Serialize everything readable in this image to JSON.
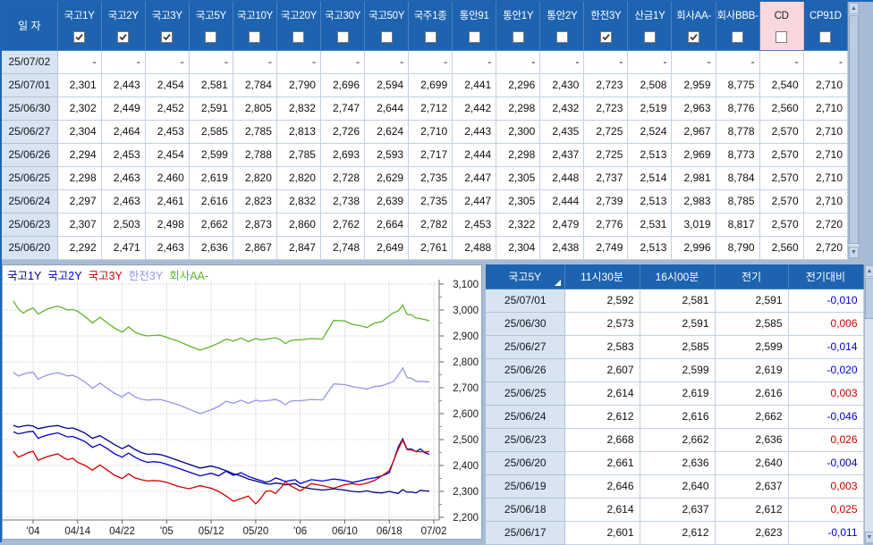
{
  "colors": {
    "header_blue": "#1E63B0",
    "date_col_bg": "#D8E4F1",
    "cd_header_pink": "#F8D8DC",
    "diff_positive": "#CC0000",
    "diff_negative": "#0000CC",
    "frame_bg": "#A8BBD5"
  },
  "top_table": {
    "date_header": "일 자",
    "columns": [
      {
        "label": "국고1Y",
        "checked": true,
        "pink": false
      },
      {
        "label": "국고2Y",
        "checked": true,
        "pink": false
      },
      {
        "label": "국고3Y",
        "checked": true,
        "pink": false
      },
      {
        "label": "국고5Y",
        "checked": false,
        "pink": false
      },
      {
        "label": "국고10Y",
        "checked": false,
        "pink": false
      },
      {
        "label": "국고20Y",
        "checked": false,
        "pink": false
      },
      {
        "label": "국고30Y",
        "checked": false,
        "pink": false
      },
      {
        "label": "국고50Y",
        "checked": false,
        "pink": false
      },
      {
        "label": "국주1종",
        "checked": false,
        "pink": false
      },
      {
        "label": "통안91",
        "checked": false,
        "pink": false
      },
      {
        "label": "통안1Y",
        "checked": false,
        "pink": false
      },
      {
        "label": "통안2Y",
        "checked": false,
        "pink": false
      },
      {
        "label": "한전3Y",
        "checked": true,
        "pink": false
      },
      {
        "label": "산금1Y",
        "checked": false,
        "pink": false
      },
      {
        "label": "회사AA-",
        "checked": true,
        "pink": false
      },
      {
        "label": "회사BBB-",
        "checked": false,
        "pink": false
      },
      {
        "label": "CD",
        "checked": false,
        "pink": true
      },
      {
        "label": "CP91D",
        "checked": false,
        "pink": false
      }
    ],
    "rows": [
      {
        "date": "25/07/02",
        "values": [
          "-",
          "-",
          "-",
          "-",
          "-",
          "-",
          "-",
          "-",
          "-",
          "-",
          "-",
          "-",
          "-",
          "-",
          "-",
          "-",
          "-",
          "-"
        ]
      },
      {
        "date": "25/07/01",
        "values": [
          "2,301",
          "2,443",
          "2,454",
          "2,581",
          "2,784",
          "2,790",
          "2,696",
          "2,594",
          "2,699",
          "2,441",
          "2,296",
          "2,430",
          "2,723",
          "2,508",
          "2,959",
          "8,775",
          "2,540",
          "2,710"
        ]
      },
      {
        "date": "25/06/30",
        "values": [
          "2,302",
          "2,449",
          "2,452",
          "2,591",
          "2,805",
          "2,832",
          "2,747",
          "2,644",
          "2,712",
          "2,442",
          "2,298",
          "2,432",
          "2,723",
          "2,519",
          "2,963",
          "8,776",
          "2,560",
          "2,710"
        ]
      },
      {
        "date": "25/06/27",
        "values": [
          "2,304",
          "2,464",
          "2,453",
          "2,585",
          "2,785",
          "2,813",
          "2,726",
          "2,624",
          "2,710",
          "2,443",
          "2,300",
          "2,435",
          "2,725",
          "2,524",
          "2,967",
          "8,778",
          "2,570",
          "2,710"
        ]
      },
      {
        "date": "25/06/26",
        "values": [
          "2,294",
          "2,453",
          "2,454",
          "2,599",
          "2,788",
          "2,785",
          "2,693",
          "2,593",
          "2,717",
          "2,444",
          "2,298",
          "2,437",
          "2,725",
          "2,513",
          "2,969",
          "8,773",
          "2,570",
          "2,710"
        ]
      },
      {
        "date": "25/06/25",
        "values": [
          "2,298",
          "2,463",
          "2,460",
          "2,619",
          "2,820",
          "2,820",
          "2,728",
          "2,629",
          "2,735",
          "2,447",
          "2,305",
          "2,448",
          "2,737",
          "2,514",
          "2,981",
          "8,784",
          "2,570",
          "2,710"
        ]
      },
      {
        "date": "25/06/24",
        "values": [
          "2,297",
          "2,463",
          "2,461",
          "2,616",
          "2,823",
          "2,832",
          "2,738",
          "2,639",
          "2,735",
          "2,447",
          "2,305",
          "2,444",
          "2,739",
          "2,513",
          "2,983",
          "8,785",
          "2,570",
          "2,710"
        ]
      },
      {
        "date": "25/06/23",
        "values": [
          "2,307",
          "2,503",
          "2,498",
          "2,662",
          "2,873",
          "2,860",
          "2,762",
          "2,664",
          "2,782",
          "2,453",
          "2,322",
          "2,479",
          "2,776",
          "2,531",
          "3,019",
          "8,817",
          "2,570",
          "2,720"
        ]
      },
      {
        "date": "25/06/20",
        "values": [
          "2,292",
          "2,471",
          "2,463",
          "2,636",
          "2,867",
          "2,847",
          "2,748",
          "2,649",
          "2,761",
          "2,488",
          "2,304",
          "2,438",
          "2,749",
          "2,513",
          "2,996",
          "8,790",
          "2,560",
          "2,720"
        ]
      }
    ]
  },
  "detail_table": {
    "columns": [
      "국고5Y",
      "11시30분",
      "16시00분",
      "전기",
      "전기대비"
    ],
    "rows": [
      {
        "date": "25/07/01",
        "t1130": "2,592",
        "t1600": "2,581",
        "prev": "2,591",
        "diff": "-0,010"
      },
      {
        "date": "25/06/30",
        "t1130": "2,573",
        "t1600": "2,591",
        "prev": "2,585",
        "diff": "0,006"
      },
      {
        "date": "25/06/27",
        "t1130": "2,583",
        "t1600": "2,585",
        "prev": "2,599",
        "diff": "-0,014"
      },
      {
        "date": "25/06/26",
        "t1130": "2,607",
        "t1600": "2,599",
        "prev": "2,619",
        "diff": "-0,020"
      },
      {
        "date": "25/06/25",
        "t1130": "2,614",
        "t1600": "2,619",
        "prev": "2,616",
        "diff": "0,003"
      },
      {
        "date": "25/06/24",
        "t1130": "2,612",
        "t1600": "2,616",
        "prev": "2,662",
        "diff": "-0,046"
      },
      {
        "date": "25/06/23",
        "t1130": "2,668",
        "t1600": "2,662",
        "prev": "2,636",
        "diff": "0,026"
      },
      {
        "date": "25/06/20",
        "t1130": "2,661",
        "t1600": "2,636",
        "prev": "2,640",
        "diff": "-0,004"
      },
      {
        "date": "25/06/19",
        "t1130": "2,646",
        "t1600": "2,640",
        "prev": "2,637",
        "diff": "0,003"
      },
      {
        "date": "25/06/18",
        "t1130": "2,614",
        "t1600": "2,637",
        "prev": "2,612",
        "diff": "0,025"
      },
      {
        "date": "25/06/17",
        "t1130": "2,601",
        "t1600": "2,612",
        "prev": "2,623",
        "diff": "-0,011"
      }
    ]
  },
  "chart_data": {
    "type": "line",
    "title": "",
    "xlabel": "",
    "ylabel": "",
    "ylim": [
      2.2,
      3.1
    ],
    "grid": true,
    "legend_position": "top-left",
    "y_ticks": [
      3.1,
      3.0,
      2.9,
      2.8,
      2.7,
      2.6,
      2.5,
      2.4,
      2.3,
      2.2
    ],
    "y_tick_labels": [
      "3,100",
      "3,000",
      "2,900",
      "2,800",
      "2,700",
      "2,600",
      "2,500",
      "2,400",
      "2,300",
      "2,200"
    ],
    "x_tick_labels": [
      "'04",
      "04/14",
      "04/22",
      "'05",
      "05/12",
      "05/20",
      "'06",
      "06/10",
      "06/18",
      "07/02"
    ],
    "x_tick_anchors": [
      4,
      13,
      19,
      26,
      30,
      36,
      45,
      49,
      55,
      65
    ],
    "series": [
      {
        "name": "국고1Y",
        "color": "#000080",
        "values": [
          2.555,
          2.548,
          2.552,
          2.555,
          2.552,
          2.542,
          2.546,
          2.55,
          2.552,
          2.554,
          2.548,
          2.543,
          2.545,
          2.538,
          2.525,
          2.505,
          2.515,
          2.498,
          2.48,
          2.465,
          2.478,
          2.462,
          2.45,
          2.443,
          2.445,
          2.442,
          2.435,
          2.42,
          2.405,
          2.39,
          2.398,
          2.39,
          2.38,
          2.368,
          2.36,
          2.348,
          2.34,
          2.335,
          2.33,
          2.328,
          2.332,
          2.33,
          2.325,
          2.328,
          2.33,
          2.318,
          2.31,
          2.305,
          2.31,
          2.305,
          2.3,
          2.298,
          2.302,
          2.296,
          2.294,
          2.3,
          2.296,
          2.292,
          2.307,
          2.297,
          2.298,
          2.294,
          2.304,
          2.302,
          2.301
        ]
      },
      {
        "name": "국고2Y",
        "color": "#0000CD",
        "values": [
          2.53,
          2.522,
          2.526,
          2.53,
          2.532,
          2.505,
          2.512,
          2.518,
          2.522,
          2.526,
          2.518,
          2.51,
          2.512,
          2.505,
          2.492,
          2.47,
          2.482,
          2.465,
          2.445,
          2.432,
          2.448,
          2.432,
          2.42,
          2.412,
          2.415,
          2.412,
          2.405,
          2.39,
          2.375,
          2.36,
          2.37,
          2.36,
          2.378,
          2.362,
          2.372,
          2.358,
          2.348,
          2.342,
          2.336,
          2.34,
          2.352,
          2.346,
          2.338,
          2.342,
          2.345,
          2.33,
          2.345,
          2.34,
          2.348,
          2.342,
          2.335,
          2.34,
          2.348,
          2.352,
          2.36,
          2.372,
          2.42,
          2.471,
          2.503,
          2.463,
          2.463,
          2.453,
          2.464,
          2.449,
          2.443
        ]
      },
      {
        "name": "국고3Y",
        "color": "#CC0000",
        "values": [
          2.455,
          2.432,
          2.44,
          2.45,
          2.455,
          2.42,
          2.428,
          2.435,
          2.44,
          2.445,
          2.432,
          2.422,
          2.428,
          2.412,
          2.4,
          2.382,
          2.402,
          2.382,
          2.362,
          2.35,
          2.368,
          2.352,
          2.345,
          2.34,
          2.342,
          2.34,
          2.335,
          2.32,
          2.31,
          2.322,
          2.312,
          2.3,
          2.282,
          2.262,
          2.272,
          2.282,
          2.252,
          2.272,
          2.3,
          2.302,
          2.292,
          2.312,
          2.336,
          2.322,
          2.312,
          2.302,
          2.33,
          2.322,
          2.312,
          2.326,
          2.33,
          2.326,
          2.332,
          2.342,
          2.36,
          2.38,
          2.42,
          2.463,
          2.498,
          2.461,
          2.46,
          2.454,
          2.453,
          2.452,
          2.454
        ]
      },
      {
        "name": "한전3Y",
        "color": "#9595E8",
        "values": [
          2.76,
          2.745,
          2.752,
          2.758,
          2.76,
          2.733,
          2.742,
          2.75,
          2.754,
          2.758,
          2.752,
          2.746,
          2.748,
          2.74,
          2.722,
          2.698,
          2.718,
          2.698,
          2.678,
          2.665,
          2.682,
          2.665,
          2.656,
          2.652,
          2.654,
          2.655,
          2.648,
          2.635,
          2.618,
          2.6,
          2.615,
          2.628,
          2.648,
          2.64,
          2.652,
          2.64,
          2.652,
          2.648,
          2.65,
          2.652,
          2.655,
          2.648,
          2.635,
          2.648,
          2.65,
          2.65,
          2.655,
          2.653,
          2.715,
          2.712,
          2.705,
          2.7,
          2.695,
          2.705,
          2.708,
          2.718,
          2.725,
          2.749,
          2.776,
          2.739,
          2.737,
          2.725,
          2.725,
          2.723,
          2.723
        ]
      },
      {
        "name": "회사AA-",
        "color": "#5FB32A",
        "values": [
          3.035,
          3.005,
          2.988,
          3.0,
          3.008,
          2.985,
          2.995,
          3.005,
          3.01,
          3.015,
          3.008,
          3.0,
          3.002,
          2.995,
          2.975,
          2.95,
          2.972,
          2.95,
          2.93,
          2.915,
          2.935,
          2.915,
          2.905,
          2.9,
          2.902,
          2.903,
          2.895,
          2.88,
          2.862,
          2.845,
          2.86,
          2.872,
          2.888,
          2.88,
          2.892,
          2.878,
          2.89,
          2.885,
          2.887,
          2.89,
          2.893,
          2.885,
          2.87,
          2.882,
          2.885,
          2.885,
          2.89,
          2.888,
          2.96,
          2.958,
          2.945,
          2.94,
          2.932,
          2.95,
          2.955,
          2.978,
          2.99,
          2.996,
          3.019,
          2.983,
          2.981,
          2.969,
          2.967,
          2.963,
          2.959
        ]
      }
    ]
  }
}
